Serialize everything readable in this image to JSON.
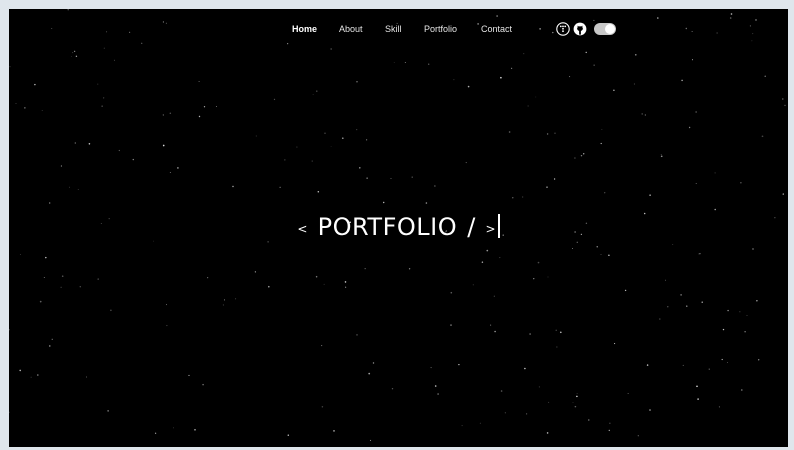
{
  "nav": {
    "items": [
      {
        "label": "Home",
        "active": true
      },
      {
        "label": "About",
        "active": false
      },
      {
        "label": "Skill",
        "active": false
      },
      {
        "label": "Portfolio",
        "active": false
      },
      {
        "label": "Contact",
        "active": false
      }
    ]
  },
  "icons": [
    "tistory-icon",
    "github-icon"
  ],
  "theme_toggle": {
    "on": true
  },
  "hero": {
    "open_bracket": "<",
    "title": "PORTFOLIO",
    "slash": "/",
    "close_bracket": ">"
  },
  "colors": {
    "background": "#000000",
    "text": "#ffffff",
    "toggle_track": "#c8c8c8"
  }
}
